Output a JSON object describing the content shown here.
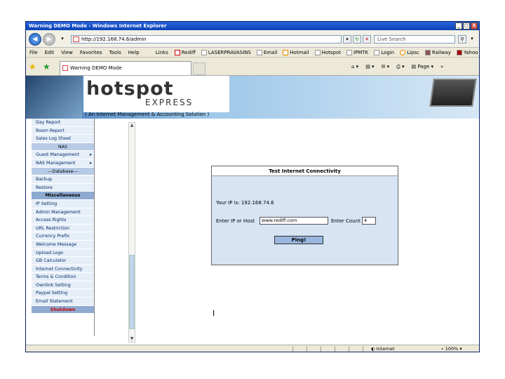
{
  "window": {
    "title": "Warning DEMO Mode - Windows Internet Explorer",
    "min": "_",
    "max": "□",
    "close": "X"
  },
  "address": {
    "url": "http://192.168.74.6/admin",
    "search_placeholder": "Live Search"
  },
  "menu": [
    "File",
    "Edit",
    "View",
    "Favorites",
    "Tools",
    "Help"
  ],
  "links_label": "Links",
  "links": [
    "Rediff",
    "LASERPRAVASINS",
    "Email",
    "Hotmail",
    "Hotspot",
    "IPMTK",
    "Login",
    "Lipsc",
    "Railway",
    "Yahoo"
  ],
  "tab": {
    "title": "Warning DEMO Mode"
  },
  "commands": {
    "page": "Page"
  },
  "banner": {
    "logo": "hotspot",
    "logo_sub": "EXPRESS",
    "tagline": "( An Internet Management & Accounting Solution )"
  },
  "sidebar": [
    {
      "label": "Day Report",
      "type": "item"
    },
    {
      "label": "Room Report",
      "type": "item"
    },
    {
      "label": "Sales Log Sheet",
      "type": "item"
    },
    {
      "label": "NAS",
      "type": "head"
    },
    {
      "label": "Guest Management",
      "type": "item",
      "arrow": "▸"
    },
    {
      "label": "NAS Management",
      "type": "item",
      "arrow": "▸"
    },
    {
      "label": "---Database---",
      "type": "head"
    },
    {
      "label": "Backup",
      "type": "item"
    },
    {
      "label": "Restore",
      "type": "item"
    },
    {
      "label": "Miscellaneous",
      "type": "dark"
    },
    {
      "label": "IP Setting",
      "type": "item"
    },
    {
      "label": "Admin Management",
      "type": "item"
    },
    {
      "label": "Access Rights",
      "type": "item"
    },
    {
      "label": "URL Restriction",
      "type": "item"
    },
    {
      "label": "Currency Prefix",
      "type": "item"
    },
    {
      "label": "Welcome Message",
      "type": "item"
    },
    {
      "label": "Upload Logo",
      "type": "item"
    },
    {
      "label": "GB Calculator",
      "type": "item"
    },
    {
      "label": "Internet Connectivity",
      "type": "item"
    },
    {
      "label": "Terms & Condition",
      "type": "item"
    },
    {
      "label": "Ownlink Setting",
      "type": "item"
    },
    {
      "label": "Paypal Setting",
      "type": "item"
    },
    {
      "label": "Email Statement",
      "type": "item"
    },
    {
      "label": "Shutdown",
      "type": "shut"
    }
  ],
  "panel": {
    "title": "Test Internet Connectivity",
    "your_ip_label": "Your IP is: 192.168.74.6",
    "host_label": "Enter IP or Host",
    "host_value": "www.rediff.com",
    "count_label": "Enter Count",
    "count_value": "4",
    "ping_label": "Ping!"
  },
  "status": {
    "zone": "Internet",
    "zoom": "100%"
  }
}
